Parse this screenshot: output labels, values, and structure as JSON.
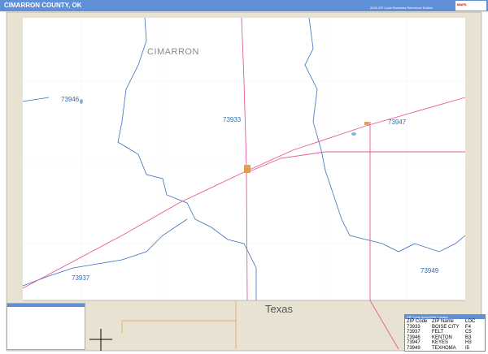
{
  "header": {
    "title": "CIMARRON COUNTY, OK",
    "edition": "2026 ZIP Code Business Reference Edition",
    "logo": "MAPS"
  },
  "map": {
    "county_label": "CIMARRON",
    "state_label": "Texas",
    "zip_labels": [
      "73946",
      "73933",
      "73947",
      "73937",
      "73949"
    ],
    "colors": {
      "zip_boundary": "#3a6fc0",
      "road": "#e8579a",
      "land_outside": "#e8e2d2",
      "header": "#5f8fd6"
    }
  },
  "index": {
    "title": "ZIP Code Index/Grid Locator",
    "columns": [
      "ZIP Code",
      "ZIP Name",
      "LOC"
    ],
    "rows": [
      [
        "73933",
        "BOISE CITY",
        "F4"
      ],
      [
        "73937",
        "FELT",
        "C5"
      ],
      [
        "73946",
        "KENTON",
        "B3"
      ],
      [
        "73947",
        "KEYES",
        "H3"
      ],
      [
        "73949",
        "TEXHOMA",
        "I5"
      ]
    ]
  }
}
